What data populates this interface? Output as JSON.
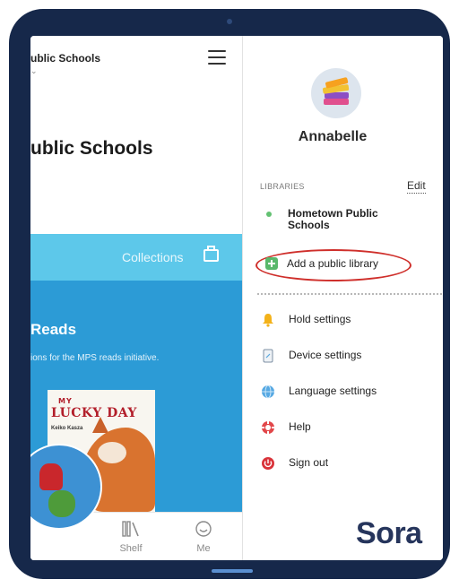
{
  "left_pane": {
    "topbar_title": "ublic Schools",
    "page_title": "ublic Schools",
    "collections_label": "Collections",
    "section_title": "Reads",
    "section_description": "ions for the MPS reads initiative.",
    "book": {
      "title_top": "MY",
      "title_main": "LUCKY DAY",
      "author": "Keiko Kasza"
    },
    "bottom_nav": {
      "shelf_label": "Shelf",
      "me_label": "Me"
    }
  },
  "menu": {
    "user_name": "Annabelle",
    "libraries_label": "LIBRARIES",
    "edit_label": "Edit",
    "library_name": "Hometown Public Schools",
    "add_library_label": "Add a public library",
    "items": [
      {
        "label": "Hold settings",
        "icon": "bell-icon"
      },
      {
        "label": "Device settings",
        "icon": "device-icon"
      },
      {
        "label": "Language settings",
        "icon": "globe-icon"
      },
      {
        "label": "Help",
        "icon": "lifebuoy-icon"
      },
      {
        "label": "Sign out",
        "icon": "power-icon"
      }
    ],
    "logo_text": "Sora"
  },
  "colors": {
    "device_frame": "#16284a",
    "collections_bar": "#5dc8ea",
    "blue_panel": "#2c9bd6",
    "highlight_oval": "#cf2f2b",
    "library_dot": "#63c172",
    "logo": "#26355c"
  }
}
